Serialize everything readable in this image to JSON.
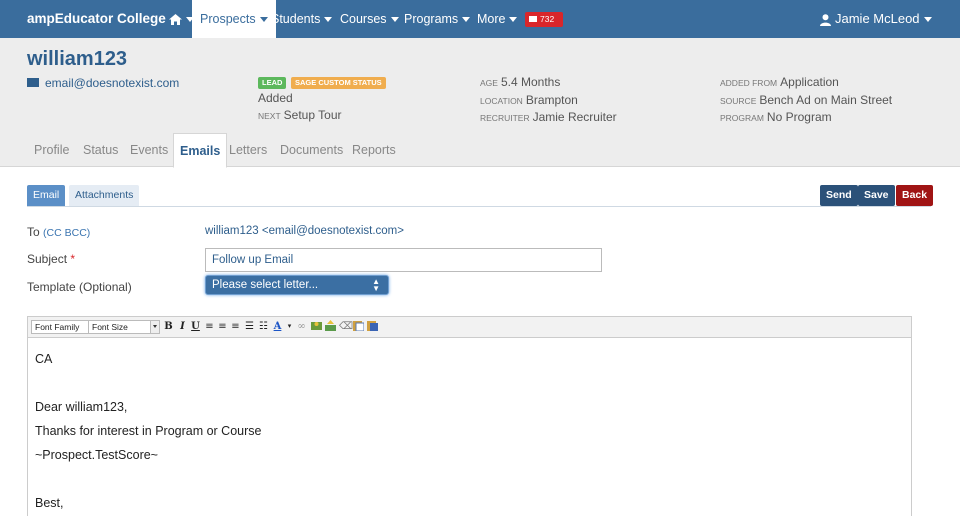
{
  "navbar": {
    "brand": "ampEducator College",
    "items": [
      "Prospects",
      "Students",
      "Courses",
      "Programs",
      "More"
    ],
    "mail_count": "732",
    "user": "Jamie McLeod"
  },
  "prospect": {
    "name": "william123",
    "email": "email@doesnotexist.com",
    "badges": [
      "LEAD",
      "SAGE CUSTOM STATUS"
    ],
    "status": "Added",
    "next_label": "NEXT",
    "next_value": "Setup Tour",
    "age_label": "AGE",
    "age_value": "5.4 Months",
    "location_label": "LOCATION",
    "location_value": "Brampton",
    "recruiter_label": "RECRUITER",
    "recruiter_value": "Jamie Recruiter",
    "added_from_label": "ADDED FROM",
    "added_from_value": "Application",
    "source_label": "SOURCE",
    "source_value": "Bench Ad on Main Street",
    "program_label": "PROGRAM",
    "program_value": "No Program"
  },
  "tabs": [
    "Profile",
    "Status",
    "Events",
    "Emails",
    "Letters",
    "Documents",
    "Reports"
  ],
  "subtabs": [
    "Email",
    "Attachments"
  ],
  "actions": {
    "send": "Send",
    "save": "Save",
    "back": "Back"
  },
  "form": {
    "to_label": "To",
    "cc_bcc": "(CC BCC)",
    "to_value": "william123 <email@doesnotexist.com>",
    "subject_label": "Subject",
    "required_mark": "*",
    "subject_value": "Follow up Email",
    "template_label": "Template (Optional)",
    "template_value": "Please select letter..."
  },
  "editor": {
    "font_family": "Font Family",
    "font_size": "Font Size",
    "lines": [
      "CA",
      "",
      "Dear william123,",
      "Thanks for interest in Program or Course",
      "~Prospect.TestScore~",
      "",
      "Best,"
    ]
  }
}
